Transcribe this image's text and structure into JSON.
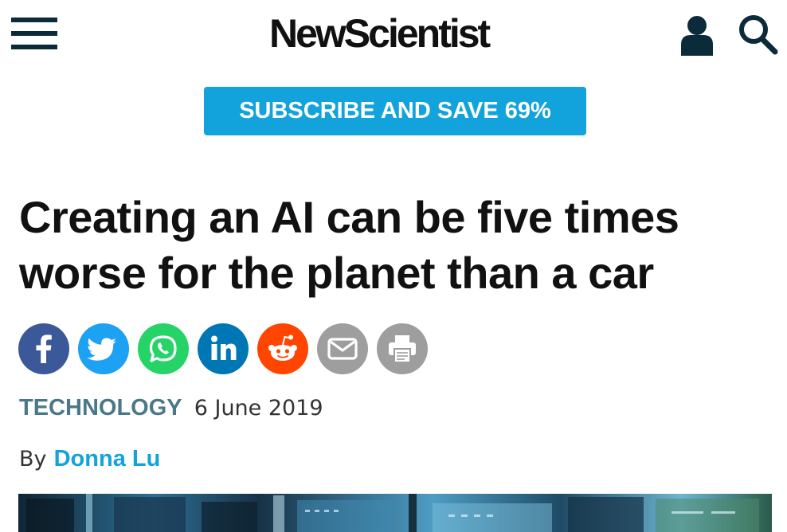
{
  "header": {
    "menu_icon": "hamburger-menu-icon",
    "logo_text": "NewScientist",
    "account_icon": "user-account-icon",
    "search_icon": "search-icon"
  },
  "subscribe": {
    "label": "SUBSCRIBE AND SAVE 69%",
    "color": "#13a3dc"
  },
  "article": {
    "headline": "Creating an AI can be five times worse for the planet than a car",
    "category": "TECHNOLOGY",
    "date": "6 June 2019",
    "by_prefix": "By",
    "author": "Donna Lu"
  },
  "share": [
    {
      "name": "facebook",
      "icon": "facebook-icon",
      "color": "#3b5998"
    },
    {
      "name": "twitter",
      "icon": "twitter-icon",
      "color": "#1da1f2"
    },
    {
      "name": "whatsapp",
      "icon": "whatsapp-icon",
      "color": "#25d366"
    },
    {
      "name": "linkedin",
      "icon": "linkedin-icon",
      "color": "#0077b5"
    },
    {
      "name": "reddit",
      "icon": "reddit-icon",
      "color": "#ff4500"
    },
    {
      "name": "email",
      "icon": "email-icon",
      "color": "#9e9e9e"
    },
    {
      "name": "print",
      "icon": "print-icon",
      "color": "#9e9e9e"
    }
  ],
  "colors": {
    "navy": "#0c2b3a",
    "category": "#4a7888",
    "accent": "#13a3dc"
  }
}
